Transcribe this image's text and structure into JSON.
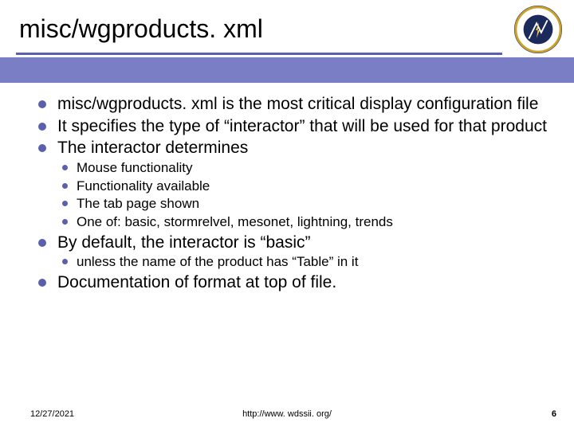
{
  "title": "misc/wgproducts. xml",
  "bullets": {
    "b1": "misc/wgproducts. xml is the most critical display configuration file",
    "b2": "It specifies the type of “interactor” that will be used for that product",
    "b3": "The interactor determines",
    "b3_sub": {
      "s1": "Mouse functionality",
      "s2": "Functionality available",
      "s3": "The tab page shown",
      "s4": "One of: basic, stormrelvel, mesonet, lightning, trends"
    },
    "b4": "By default, the interactor is “basic”",
    "b4_sub": {
      "s1": "unless the name of the product has “Table” in it"
    },
    "b5": "Documentation of format at top of file."
  },
  "footer": {
    "date": "12/27/2021",
    "url": "http://www. wdssii. org/",
    "page": "6"
  },
  "logo_alt": "NSSL National Severe Storms Laboratory"
}
